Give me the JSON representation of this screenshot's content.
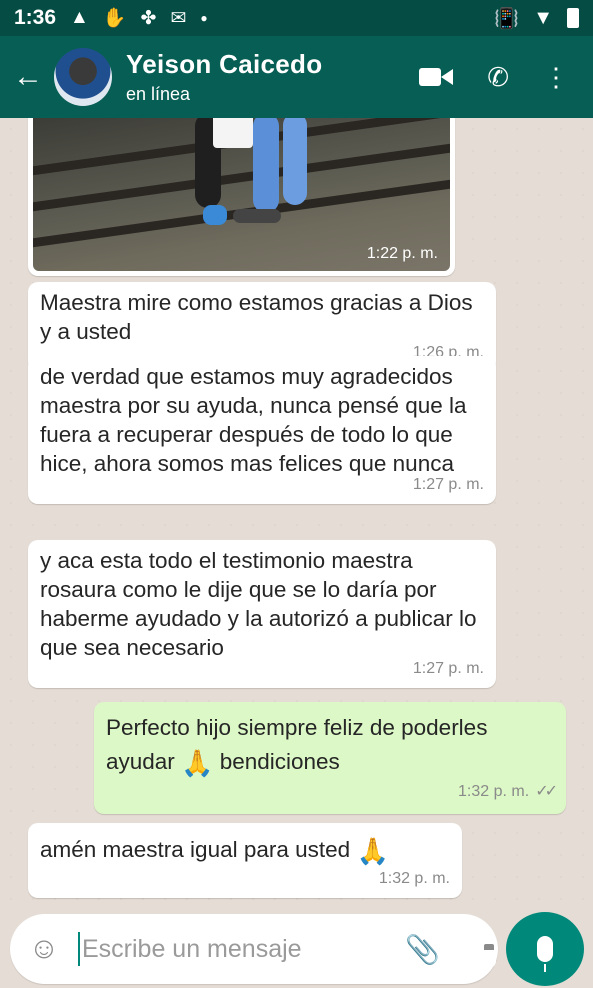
{
  "status_bar": {
    "time": "1:36",
    "icons": [
      "warning-icon",
      "hand-icon",
      "fan-icon",
      "gmail-icon",
      "dot-icon",
      "vibrate-icon",
      "wifi-icon",
      "battery-icon"
    ]
  },
  "header": {
    "back_icon": "arrow-left-icon",
    "contact_name": "Yeison Caicedo",
    "contact_status": "en línea",
    "actions": [
      "video-call-icon",
      "phone-icon",
      "more-options-icon"
    ]
  },
  "messages": [
    {
      "type": "image",
      "direction": "in",
      "time": "1:22 p. m."
    },
    {
      "type": "text",
      "direction": "in",
      "text": "Maestra mire como estamos gracias a Dios y a usted",
      "time": "1:26 p. m."
    },
    {
      "type": "text",
      "direction": "in",
      "text": "de verdad que estamos muy agradecidos maestra por su ayuda, nunca pensé que la fuera a recuperar después de todo lo que hice, ahora somos mas felices que nunca",
      "time": "1:27 p. m."
    },
    {
      "type": "text",
      "direction": "in",
      "text": "y aca esta todo el testimonio maestra rosaura como le dije que se lo daría por haberme ayudado y la autorizó a publicar lo que sea necesario",
      "time": "1:27 p. m."
    },
    {
      "type": "text",
      "direction": "out",
      "text_before": "Perfecto hijo siempre feliz de poderles ayudar",
      "emoji": "🙏",
      "text_after": "bendiciones",
      "time": "1:32 p. m.",
      "status": "read"
    },
    {
      "type": "text",
      "direction": "in",
      "text": "amén maestra igual para usted",
      "emoji": "🙏",
      "time": "1:32 p. m."
    }
  ],
  "composer": {
    "placeholder": "Escribe un mensaje",
    "emoji_icon": "emoji-icon",
    "attach_icon": "paperclip-icon",
    "camera_icon": "camera-icon",
    "mic_icon": "microphone-icon"
  },
  "colors": {
    "header": "#075e54",
    "status_bar": "#054d44",
    "outgoing_bubble": "#dcf8c6",
    "incoming_bubble": "#ffffff",
    "accent": "#00897b"
  }
}
